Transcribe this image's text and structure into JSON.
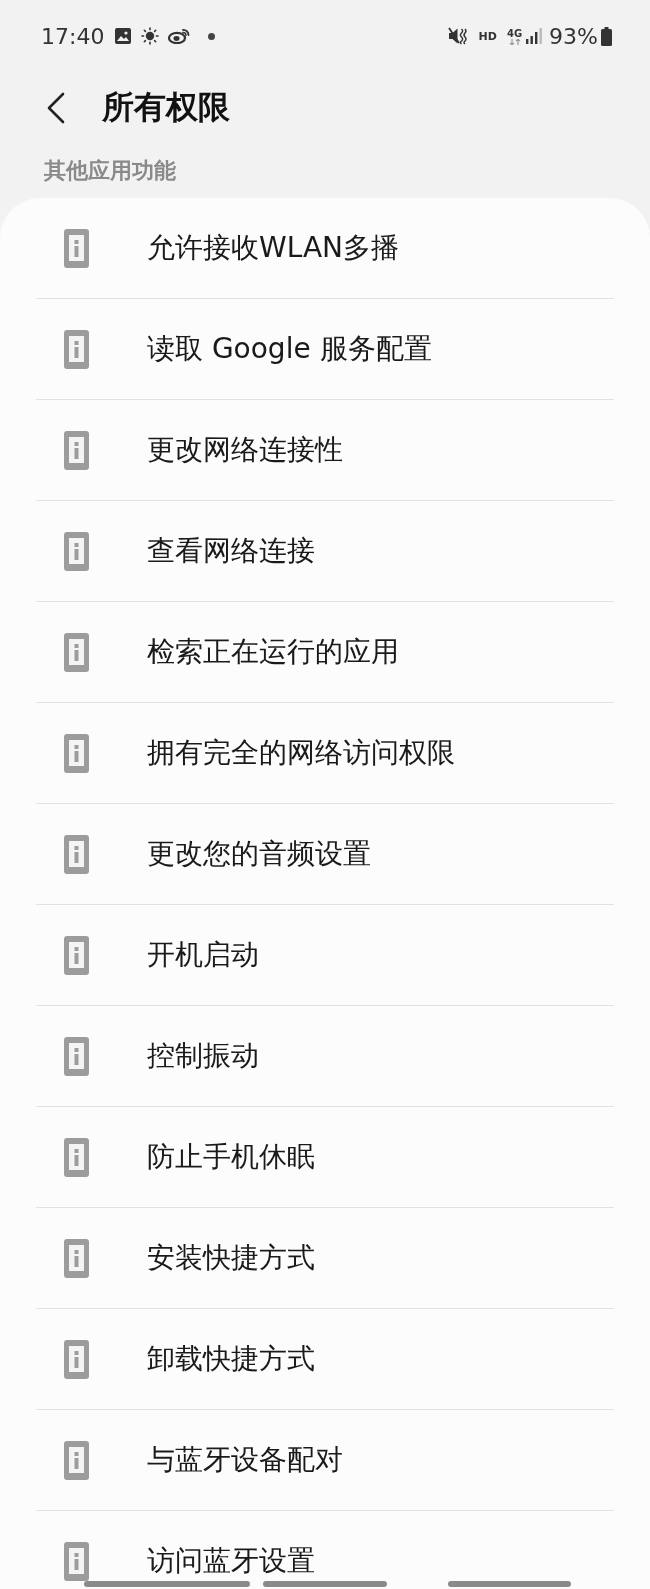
{
  "status_bar": {
    "time": "17:40",
    "hd_label": "HD",
    "network_label": "4G",
    "battery": "93%"
  },
  "header": {
    "title": "所有权限"
  },
  "section": {
    "title": "其他应用功能",
    "items": [
      "允许接收WLAN多播",
      "读取 Google 服务配置",
      "更改网络连接性",
      "查看网络连接",
      "检索正在运行的应用",
      "拥有完全的网络访问权限",
      "更改您的音频设置",
      "开机启动",
      "控制振动",
      "防止手机休眠",
      "安装快捷方式",
      "卸载快捷方式",
      "与蓝牙设备配对",
      "访问蓝牙设置"
    ]
  }
}
